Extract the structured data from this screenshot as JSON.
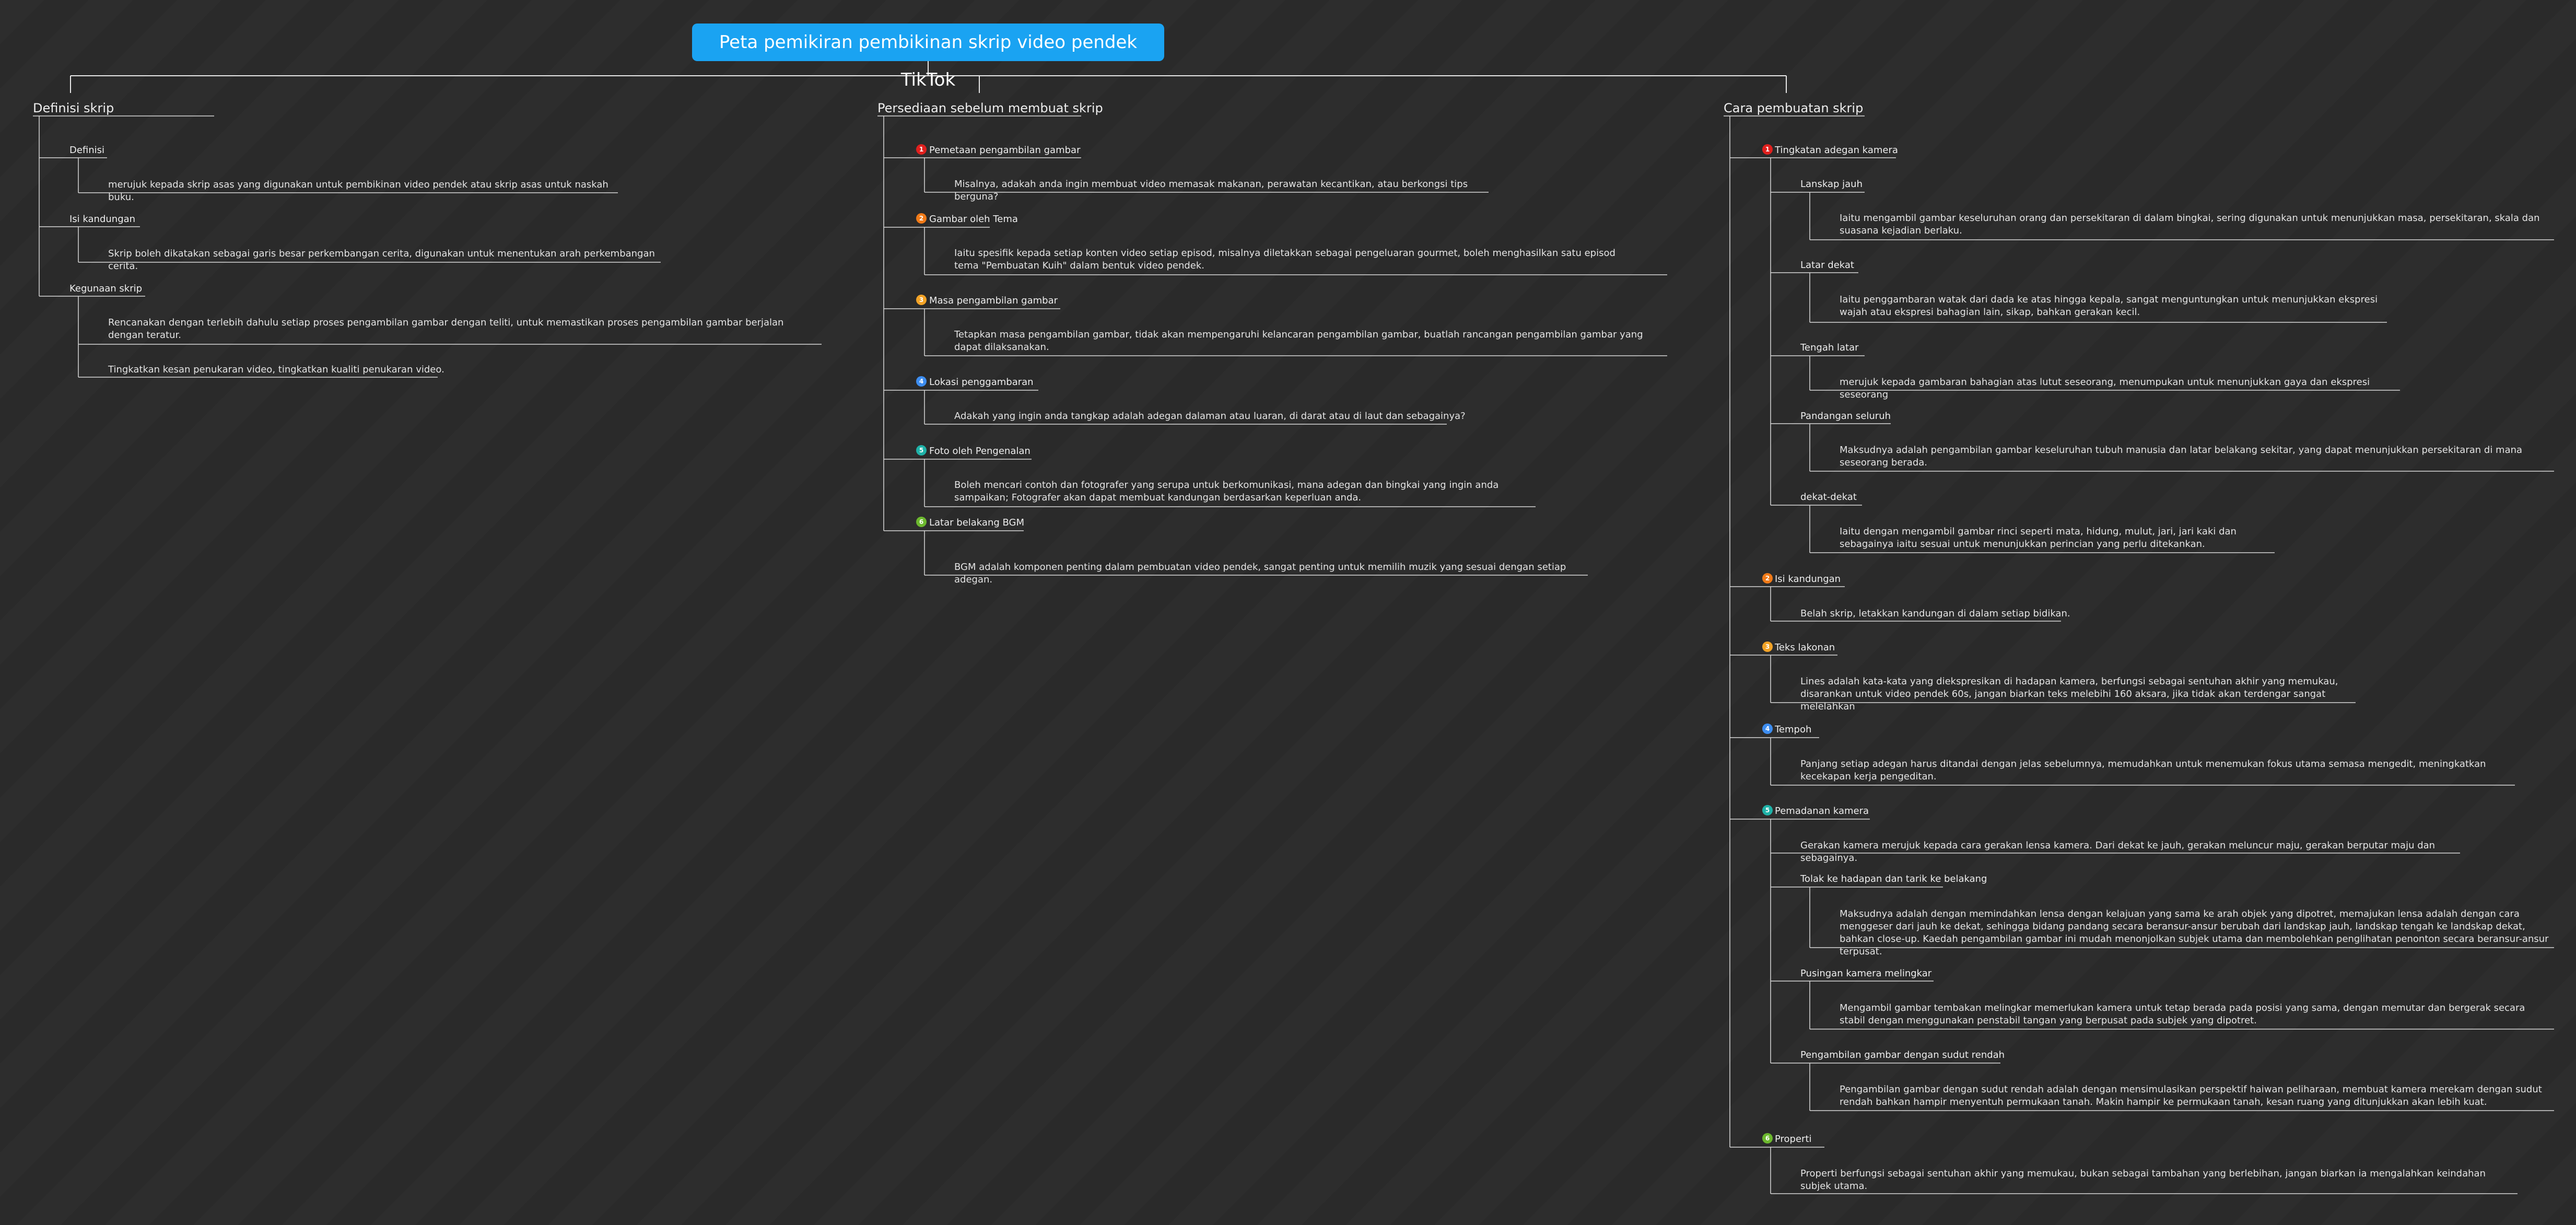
{
  "root": {
    "title": "Peta pemikiran pembikinan skrip video pendek TikTok",
    "color": "#1aa3f2"
  },
  "marker_colors": [
    "#e0201e",
    "#f07a18",
    "#f3a326",
    "#3d8df0",
    "#1fb2a8",
    "#6cb82e"
  ],
  "b1": {
    "title": "Definisi skrip",
    "t1": {
      "label": "Definisi",
      "leaf": "merujuk kepada skrip asas yang digunakan untuk pembikinan video pendek atau skrip asas untuk naskah buku."
    },
    "t2": {
      "label": "Isi kandungan",
      "leaf": "Skrip boleh dikatakan sebagai garis besar perkembangan cerita, digunakan untuk menentukan arah perkembangan cerita."
    },
    "t3": {
      "label": "Kegunaan skrip",
      "leaf1": "Rencanakan dengan terlebih dahulu setiap proses pengambilan gambar dengan teliti, untuk memastikan proses pengambilan gambar berjalan dengan teratur.",
      "leaf2": "Tingkatkan kesan penukaran video, tingkatkan kualiti penukaran video."
    }
  },
  "b2": {
    "title": "Persediaan sebelum membuat skrip",
    "t1": {
      "num": "1",
      "label": "Pemetaan pengambilan gambar",
      "leaf": "Misalnya, adakah anda ingin membuat video memasak makanan, perawatan kecantikan, atau berkongsi tips berguna?"
    },
    "t2": {
      "num": "2",
      "label": "Gambar oleh Tema",
      "leaf": "Iaitu spesifik kepada setiap konten video setiap episod, misalnya diletakkan sebagai pengeluaran gourmet, boleh menghasilkan satu episod tema \"Pembuatan Kuih\" dalam bentuk video pendek."
    },
    "t3": {
      "num": "3",
      "label": "Masa pengambilan gambar",
      "leaf": "Tetapkan masa pengambilan gambar, tidak akan mempengaruhi kelancaran pengambilan gambar, buatlah rancangan pengambilan gambar yang dapat dilaksanakan."
    },
    "t4": {
      "num": "4",
      "label": "Lokasi penggambaran",
      "leaf": "Adakah yang ingin anda tangkap adalah adegan dalaman atau luaran, di darat atau di laut dan sebagainya?"
    },
    "t5": {
      "num": "5",
      "label": "Foto oleh Pengenalan",
      "leaf": "Boleh mencari contoh dan fotografer yang serupa untuk berkomunikasi, mana adegan dan bingkai yang ingin anda sampaikan; Fotografer akan dapat membuat kandungan berdasarkan keperluan anda."
    },
    "t6": {
      "num": "6",
      "label": "Latar belakang BGM",
      "leaf": "BGM adalah komponen penting dalam pembuatan video pendek, sangat penting untuk memilih muzik yang sesuai dengan setiap adegan."
    }
  },
  "b3": {
    "title": "Cara pembuatan skrip",
    "t1": {
      "num": "1",
      "label": "Tingkatan adegan kamera",
      "s1": {
        "label": "Lanskap jauh",
        "leaf": "Iaitu mengambil gambar keseluruhan orang dan persekitaran di dalam bingkai, sering digunakan untuk menunjukkan masa, persekitaran, skala dan suasana kejadian berlaku."
      },
      "s2": {
        "label": "Latar dekat",
        "leaf": "Iaitu penggambaran watak dari dada ke atas hingga kepala, sangat menguntungkan untuk menunjukkan ekspresi wajah atau ekspresi bahagian lain, sikap, bahkan gerakan kecil."
      },
      "s3": {
        "label": "Tengah latar",
        "leaf": "merujuk kepada gambaran bahagian atas lutut seseorang, menumpukan untuk menunjukkan gaya dan ekspresi seseorang"
      },
      "s4": {
        "label": "Pandangan seluruh",
        "leaf": "Maksudnya adalah pengambilan gambar keseluruhan tubuh manusia dan latar belakang sekitar, yang dapat menunjukkan persekitaran di mana seseorang berada."
      },
      "s5": {
        "label": "dekat-dekat",
        "leaf": "Iaitu dengan mengambil gambar rinci seperti mata, hidung, mulut, jari, jari kaki dan sebagainya iaitu sesuai untuk menunjukkan perincian yang perlu ditekankan."
      }
    },
    "t2": {
      "num": "2",
      "label": "Isi kandungan",
      "leaf": "Belah skrip, letakkan kandungan di dalam setiap bidikan."
    },
    "t3": {
      "num": "3",
      "label": "Teks lakonan",
      "leaf": "Lines adalah kata-kata yang diekspresikan di hadapan kamera, berfungsi sebagai sentuhan akhir yang memukau, disarankan untuk video pendek 60s, jangan biarkan teks melebihi 160 aksara, jika tidak akan terdengar sangat melelahkan"
    },
    "t4": {
      "num": "4",
      "label": "Tempoh",
      "leaf": "Panjang setiap adegan harus ditandai dengan jelas sebelumnya, memudahkan untuk menemukan fokus utama semasa mengedit, meningkatkan kecekapan kerja pengeditan."
    },
    "t5": {
      "num": "5",
      "label": "Pemadanan kamera",
      "leaf": "Gerakan kamera merujuk kepada cara gerakan lensa kamera. Dari dekat ke jauh, gerakan meluncur maju, gerakan berputar maju dan sebagainya.",
      "s1": {
        "label": "Tolak ke hadapan dan tarik ke belakang",
        "leaf": "Maksudnya adalah dengan memindahkan lensa dengan kelajuan yang sama ke arah objek yang dipotret, memajukan lensa adalah dengan cara menggeser dari jauh ke dekat, sehingga bidang pandang secara beransur-ansur berubah dari landskap jauh, landskap tengah ke landskap dekat, bahkan close-up. Kaedah pengambilan gambar ini mudah menonjolkan subjek utama dan membolehkan penglihatan penonton secara beransur-ansur terpusat."
      },
      "s2": {
        "label": "Pusingan kamera melingkar",
        "leaf": "Mengambil gambar tembakan melingkar memerlukan kamera untuk tetap berada pada posisi yang sama, dengan memutar dan bergerak secara stabil dengan menggunakan penstabil tangan yang berpusat pada subjek yang dipotret."
      },
      "s3": {
        "label": "Pengambilan gambar dengan sudut rendah",
        "leaf": "Pengambilan gambar dengan sudut rendah adalah dengan mensimulasikan perspektif haiwan peliharaan, membuat kamera merekam dengan sudut rendah bahkan hampir menyentuh permukaan tanah. Makin hampir ke permukaan tanah, kesan ruang yang ditunjukkan akan lebih kuat."
      }
    },
    "t6": {
      "num": "6",
      "label": "Properti",
      "leaf": "Properti berfungsi sebagai sentuhan akhir yang memukau, bukan sebagai tambahan yang berlebihan, jangan biarkan ia mengalahkan keindahan subjek utama."
    }
  }
}
